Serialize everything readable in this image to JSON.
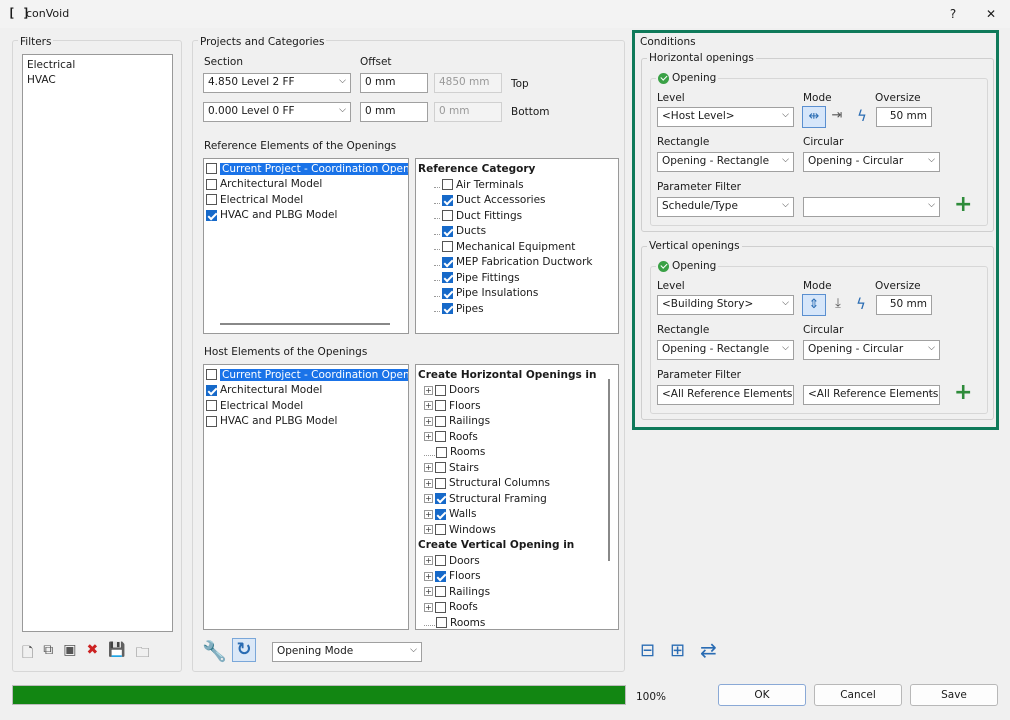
{
  "window": {
    "title": "conVoid",
    "help": "?",
    "close": "✕"
  },
  "filters": {
    "label": "Filters",
    "items": [
      "Electrical",
      "HVAC"
    ]
  },
  "projects": {
    "label": "Projects and Categories",
    "section_label": "Section",
    "offset_label": "Offset",
    "top": {
      "section": "4.850  Level 2 FF",
      "offset": "0 mm",
      "computed": "4850 mm",
      "label": "Top"
    },
    "bottom": {
      "section": "0.000  Level 0 FF",
      "offset": "0 mm",
      "computed": "0 mm",
      "label": "Bottom"
    }
  },
  "reference": {
    "label": "Reference Elements of the Openings",
    "models": [
      {
        "name": "Current Project - Coordination Openings",
        "checked": false,
        "selected": true
      },
      {
        "name": "Architectural Model",
        "checked": false
      },
      {
        "name": "Electrical Model",
        "checked": false
      },
      {
        "name": "HVAC and PLBG Model",
        "checked": true
      }
    ],
    "category_header": "Reference Category",
    "categories": [
      {
        "name": "Air Terminals",
        "checked": false
      },
      {
        "name": "Duct Accessories",
        "checked": true
      },
      {
        "name": "Duct Fittings",
        "checked": false
      },
      {
        "name": "Ducts",
        "checked": true
      },
      {
        "name": "Mechanical Equipment",
        "checked": false
      },
      {
        "name": "MEP Fabrication Ductwork",
        "checked": true
      },
      {
        "name": "Pipe Fittings",
        "checked": true
      },
      {
        "name": "Pipe Insulations",
        "checked": true
      },
      {
        "name": "Pipes",
        "checked": true
      }
    ]
  },
  "host": {
    "label": "Host Elements of the Openings",
    "models": [
      {
        "name": "Current Project - Coordination Openings",
        "checked": false,
        "selected": true
      },
      {
        "name": "Architectural Model",
        "checked": true
      },
      {
        "name": "Electrical Model",
        "checked": false
      },
      {
        "name": "HVAC and PLBG Model",
        "checked": false
      }
    ],
    "horizontal_header": "Create Horizontal Openings in",
    "horizontal": [
      {
        "name": "Doors",
        "checked": false,
        "exp": true
      },
      {
        "name": "Floors",
        "checked": false,
        "exp": true
      },
      {
        "name": "Railings",
        "checked": false,
        "exp": true
      },
      {
        "name": "Roofs",
        "checked": false,
        "exp": true
      },
      {
        "name": "Rooms",
        "checked": false,
        "exp": false
      },
      {
        "name": "Stairs",
        "checked": false,
        "exp": true
      },
      {
        "name": "Structural Columns",
        "checked": false,
        "exp": true
      },
      {
        "name": "Structural Framing",
        "checked": true,
        "exp": true
      },
      {
        "name": "Walls",
        "checked": true,
        "exp": true
      },
      {
        "name": "Windows",
        "checked": false,
        "exp": true
      }
    ],
    "vertical_header": "Create Vertical Opening in",
    "vertical": [
      {
        "name": "Doors",
        "checked": false,
        "exp": true
      },
      {
        "name": "Floors",
        "checked": true,
        "exp": true
      },
      {
        "name": "Railings",
        "checked": false,
        "exp": true
      },
      {
        "name": "Roofs",
        "checked": false,
        "exp": true
      },
      {
        "name": "Rooms",
        "checked": false,
        "exp": false
      }
    ]
  },
  "mode_select": "Opening Mode",
  "conditions": {
    "label": "Conditions",
    "horizontal": {
      "label": "Horizontal openings",
      "opening": "Opening",
      "level_label": "Level",
      "mode_label": "Mode",
      "oversize_label": "Oversize",
      "level": "<Host Level>",
      "oversize": "50 mm",
      "rect_label": "Rectangle",
      "circ_label": "Circular",
      "rect": "Opening - Rectangle",
      "circ": "Opening - Circular",
      "filter_label": "Parameter Filter",
      "filter1": "Schedule/Type",
      "filter2": ""
    },
    "vertical": {
      "label": "Vertical openings",
      "opening": "Opening",
      "level_label": "Level",
      "mode_label": "Mode",
      "oversize_label": "Oversize",
      "level": "<Building Story>",
      "oversize": "50 mm",
      "rect_label": "Rectangle",
      "circ_label": "Circular",
      "rect": "Opening - Rectangle",
      "circ": "Opening - Circular",
      "filter_label": "Parameter Filter",
      "filter1": "<All Reference Elements>",
      "filter2": "<All Reference Elements>"
    }
  },
  "progress": {
    "value": 100,
    "text": "100%"
  },
  "buttons": {
    "ok": "OK",
    "cancel": "Cancel",
    "save": "Save"
  },
  "colors": {
    "accent": "#1a73e8",
    "highlight": "#0f7a5a",
    "progress": "#128612"
  }
}
